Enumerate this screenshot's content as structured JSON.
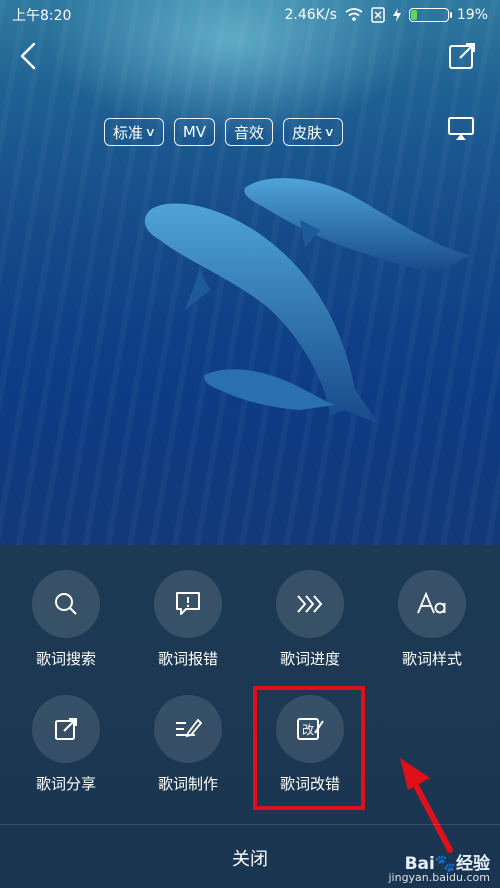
{
  "status_bar": {
    "time": "上午8:20",
    "network_speed": "2.46K/s",
    "battery_percent": "19%",
    "battery_level": 0.19
  },
  "top_bar": {
    "chips": [
      {
        "label": "标准",
        "has_dropdown": true
      },
      {
        "label": "MV",
        "has_dropdown": false
      },
      {
        "label": "音效",
        "has_dropdown": false
      },
      {
        "label": "皮肤",
        "has_dropdown": true
      }
    ]
  },
  "menu": {
    "items": [
      {
        "label": "歌词搜索",
        "icon": "search-icon"
      },
      {
        "label": "歌词报错",
        "icon": "report-icon"
      },
      {
        "label": "歌词进度",
        "icon": "progress-icon"
      },
      {
        "label": "歌词样式",
        "icon": "font-style-icon"
      },
      {
        "label": "歌词分享",
        "icon": "share-icon"
      },
      {
        "label": "歌词制作",
        "icon": "make-lyrics-icon"
      },
      {
        "label": "歌词改错",
        "icon": "correct-icon",
        "icon_text": "改"
      }
    ],
    "close_label": "关闭"
  },
  "watermark": {
    "brand": "Bai🐾经验",
    "url": "jingyan.baidu.com"
  },
  "colors": {
    "highlight": "#e10f1a",
    "battery": "#5ed85a",
    "panel": "#1d3a54"
  }
}
